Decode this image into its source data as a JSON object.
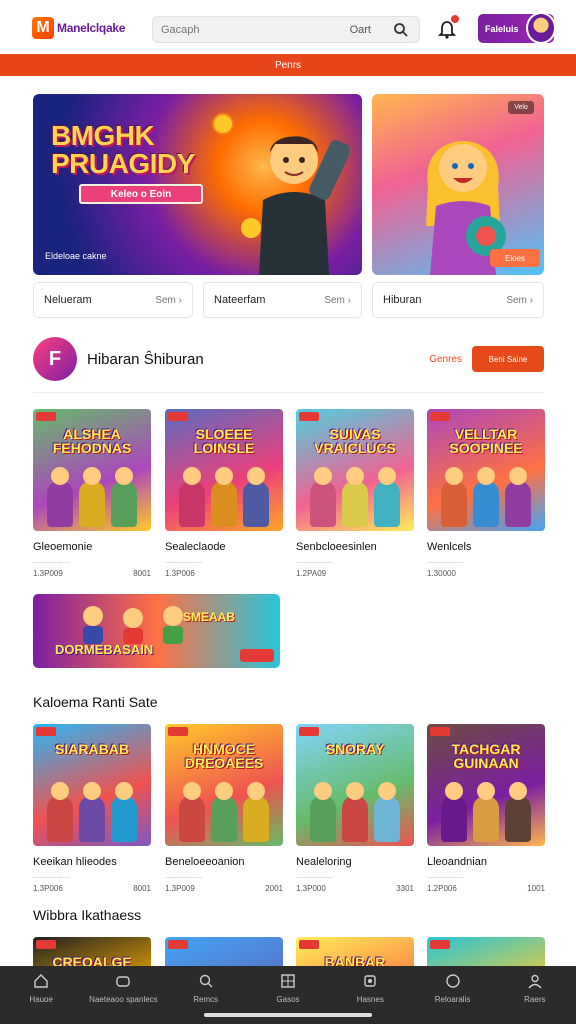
{
  "header": {
    "logo_mark": "M",
    "logo_text": "Manelclqake",
    "search_placeholder": "Gacaph",
    "search_hint": "Oart",
    "profile_label": "Faleluis"
  },
  "promo_bar": "Penrs",
  "hero": {
    "title_line1": "BMGHK",
    "title_line2": "PRUAGIDY",
    "badge": "Keleo o Eoin",
    "caption": "Eldeloae cakne",
    "side_tag": "Velo",
    "side_button": "Eloes"
  },
  "pills": [
    {
      "label": "Nelueram",
      "more": "Sem ›"
    },
    {
      "label": "Nateerfam",
      "more": "Sem ›"
    },
    {
      "label": "Hiburan",
      "more": "Sem ›"
    }
  ],
  "section1": {
    "logo_letter": "F",
    "title": "Hibaran Ŝhiburan",
    "link": "Genres",
    "button": "Beni Saine"
  },
  "section1_cards": [
    {
      "thumb": "ALSHEA FEHODNAS",
      "name": "Gleoemonie",
      "sub": "...................",
      "meta_left": "1.3P009",
      "meta_right": "8001",
      "colors": [
        "#66bb6a",
        "#ab47bc",
        "#ffca28"
      ]
    },
    {
      "thumb": "SLOEEE LOINSLE",
      "name": "Sealeclaode",
      "sub": "...................",
      "meta_left": "1.3P006",
      "meta_right": "",
      "colors": [
        "#5c6bc0",
        "#ec407a",
        "#ffa726"
      ]
    },
    {
      "thumb": "SUIVAS VRAICLUCS",
      "name": "Senbcloeesinlen",
      "sub": "...................",
      "meta_left": "1.2PA09",
      "meta_right": "",
      "colors": [
        "#4dd0e1",
        "#f06292",
        "#ffee58"
      ]
    },
    {
      "thumb": "VELLTAR SOOPINEE",
      "name": "Wenlcels",
      "sub": "...................",
      "meta_left": "1.30000",
      "meta_right": "",
      "colors": [
        "#ab47bc",
        "#ff7043",
        "#42a5f5"
      ]
    }
  ],
  "wide_banner": {
    "title_left": "DORMEBASAIN",
    "title_right": "SMEAAB"
  },
  "section2": {
    "title": "Kaloema Ranti Sate"
  },
  "section2_cards": [
    {
      "thumb": "SIARABAB",
      "name": "Keeikan hlieodes",
      "sub": "...................",
      "meta_left": "1.3P006",
      "meta_right": "8001",
      "colors": [
        "#29b6f6",
        "#ef5350",
        "#7e57c2"
      ]
    },
    {
      "thumb": "HNMOCE DREOAEES",
      "name": "Beneloeeoanion",
      "sub": "...................",
      "meta_left": "1.3P009",
      "meta_right": "2001",
      "colors": [
        "#ffca28",
        "#ef5350",
        "#66bb6a"
      ]
    },
    {
      "thumb": "SNORAY",
      "name": "Nealeloring",
      "sub": "...................",
      "meta_left": "1.3P000",
      "meta_right": "3301",
      "colors": [
        "#81d4fa",
        "#66bb6a",
        "#ef5350"
      ]
    },
    {
      "thumb": "TACHGAR GUINAAN",
      "name": "Lleoandnian",
      "sub": "...................",
      "meta_left": "1.2P006",
      "meta_right": "1001",
      "colors": [
        "#6d4c41",
        "#7b1fa2",
        "#ffb74d"
      ]
    }
  ],
  "section3": {
    "title": "Wibbra Ikathaess"
  },
  "section3_cards": [
    {
      "thumb": "CREOALGE",
      "colors": [
        "#212121",
        "#ffb300",
        "#e53935"
      ]
    },
    {
      "thumb": "",
      "colors": [
        "#42a5f5",
        "#5c6bc0",
        "#90caf9"
      ]
    },
    {
      "thumb": "BANBAR",
      "colors": [
        "#ffee58",
        "#ff7043",
        "#ab47bc"
      ]
    },
    {
      "thumb": "",
      "colors": [
        "#26c6da",
        "#ffca28",
        "#1e88e5"
      ]
    }
  ],
  "bottom_nav": [
    {
      "label": "Hauoe",
      "icon": "home-icon"
    },
    {
      "label": "Naeteaoo spanlecs",
      "icon": "controller-icon"
    },
    {
      "label": "Remcs",
      "icon": "search-icon"
    },
    {
      "label": "Gasos",
      "icon": "grid-icon"
    },
    {
      "label": "Hasnes",
      "icon": "gamepad-icon"
    },
    {
      "label": "Reloaralis",
      "icon": "circle-icon"
    },
    {
      "label": "Raers",
      "icon": "user-icon"
    }
  ]
}
